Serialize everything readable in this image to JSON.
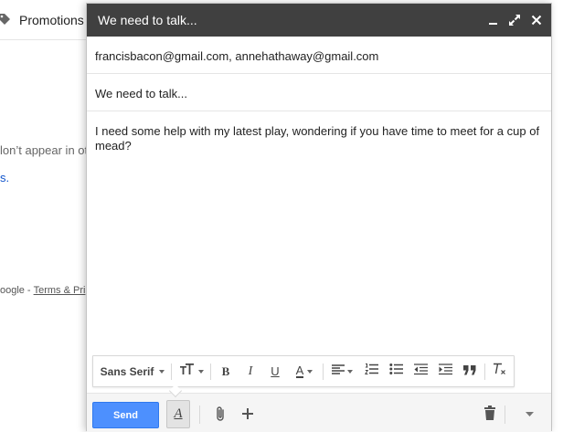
{
  "background": {
    "tab_label": "Promotions",
    "line1": "lon’t appear in ot",
    "line2": "s.",
    "footer_prefix": "oogle",
    "footer_sep": "-",
    "footer_link": "Terms & Pri"
  },
  "compose": {
    "title": "We need to talk...",
    "to": "francisbacon@gmail.com, annehathaway@gmail.com",
    "subject": "We need to talk...",
    "body": "I need some help with my latest play, wondering if you have time to meet for a cup of mead?"
  },
  "formatting": {
    "font_label": "Sans Serif",
    "bold": "B",
    "italic": "I",
    "underline": "U",
    "text_color": "A"
  },
  "bottom": {
    "send_label": "Send",
    "format_toggle": "A"
  },
  "colors": {
    "title_bar": "#404040",
    "send_button": "#4d90fe",
    "link": "#1155cc"
  }
}
